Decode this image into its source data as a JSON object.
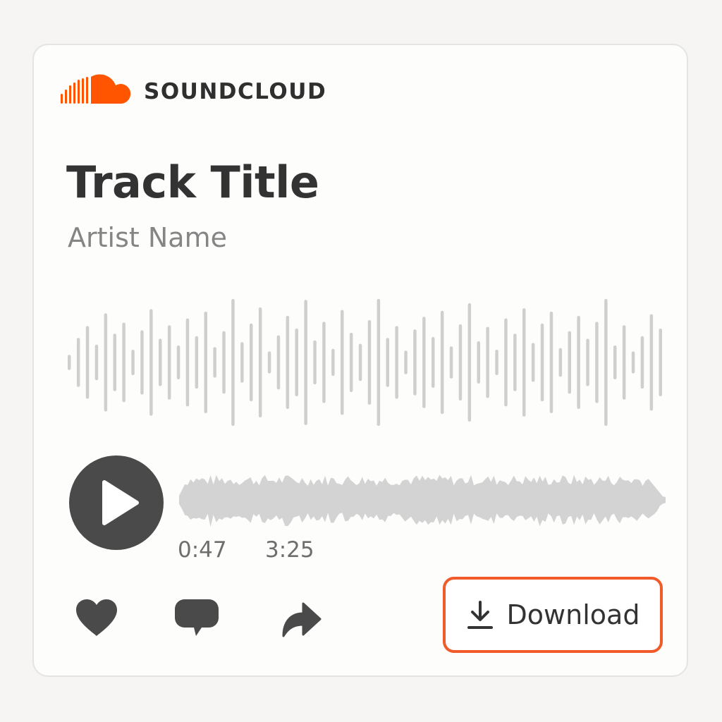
{
  "brand": {
    "name": "SOUNDCLOUD",
    "logo_icon": "soundcloud-logo-icon",
    "accent_color": "#ff5500"
  },
  "track": {
    "title": "Track Title",
    "artist": "Artist Name"
  },
  "player": {
    "play_icon": "play-icon",
    "current_time": "0:47",
    "duration": "3:25"
  },
  "actions": {
    "like_icon": "heart-icon",
    "comment_icon": "comment-icon",
    "share_icon": "share-icon"
  },
  "download": {
    "label": "Download",
    "icon": "download-icon",
    "highlight_color": "#f15b2a"
  },
  "colors": {
    "text_primary": "#333333",
    "text_secondary": "#858585",
    "waveform": "#cfcfcf",
    "control": "#4a4a4a"
  }
}
